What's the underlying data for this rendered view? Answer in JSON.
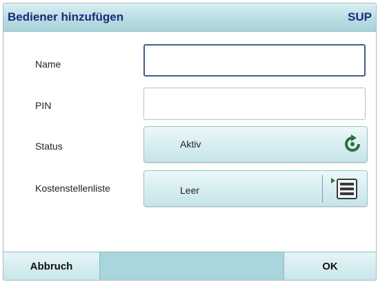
{
  "header": {
    "title": "Bediener hinzufügen",
    "mode": "SUP"
  },
  "form": {
    "name": {
      "label": "Name",
      "value": ""
    },
    "pin": {
      "label": "PIN",
      "value": ""
    },
    "status": {
      "label": "Status",
      "value": "Aktiv",
      "icon": "cycle-icon"
    },
    "cost_centers": {
      "label": "Kostenstellenliste",
      "value": "Leer",
      "icon": "list-icon"
    }
  },
  "footer": {
    "cancel_label": "Abbruch",
    "ok_label": "OK"
  },
  "colors": {
    "title_text": "#1a2a7a",
    "accent": "#a9d5dc",
    "icon_green": "#2f6f3a"
  }
}
